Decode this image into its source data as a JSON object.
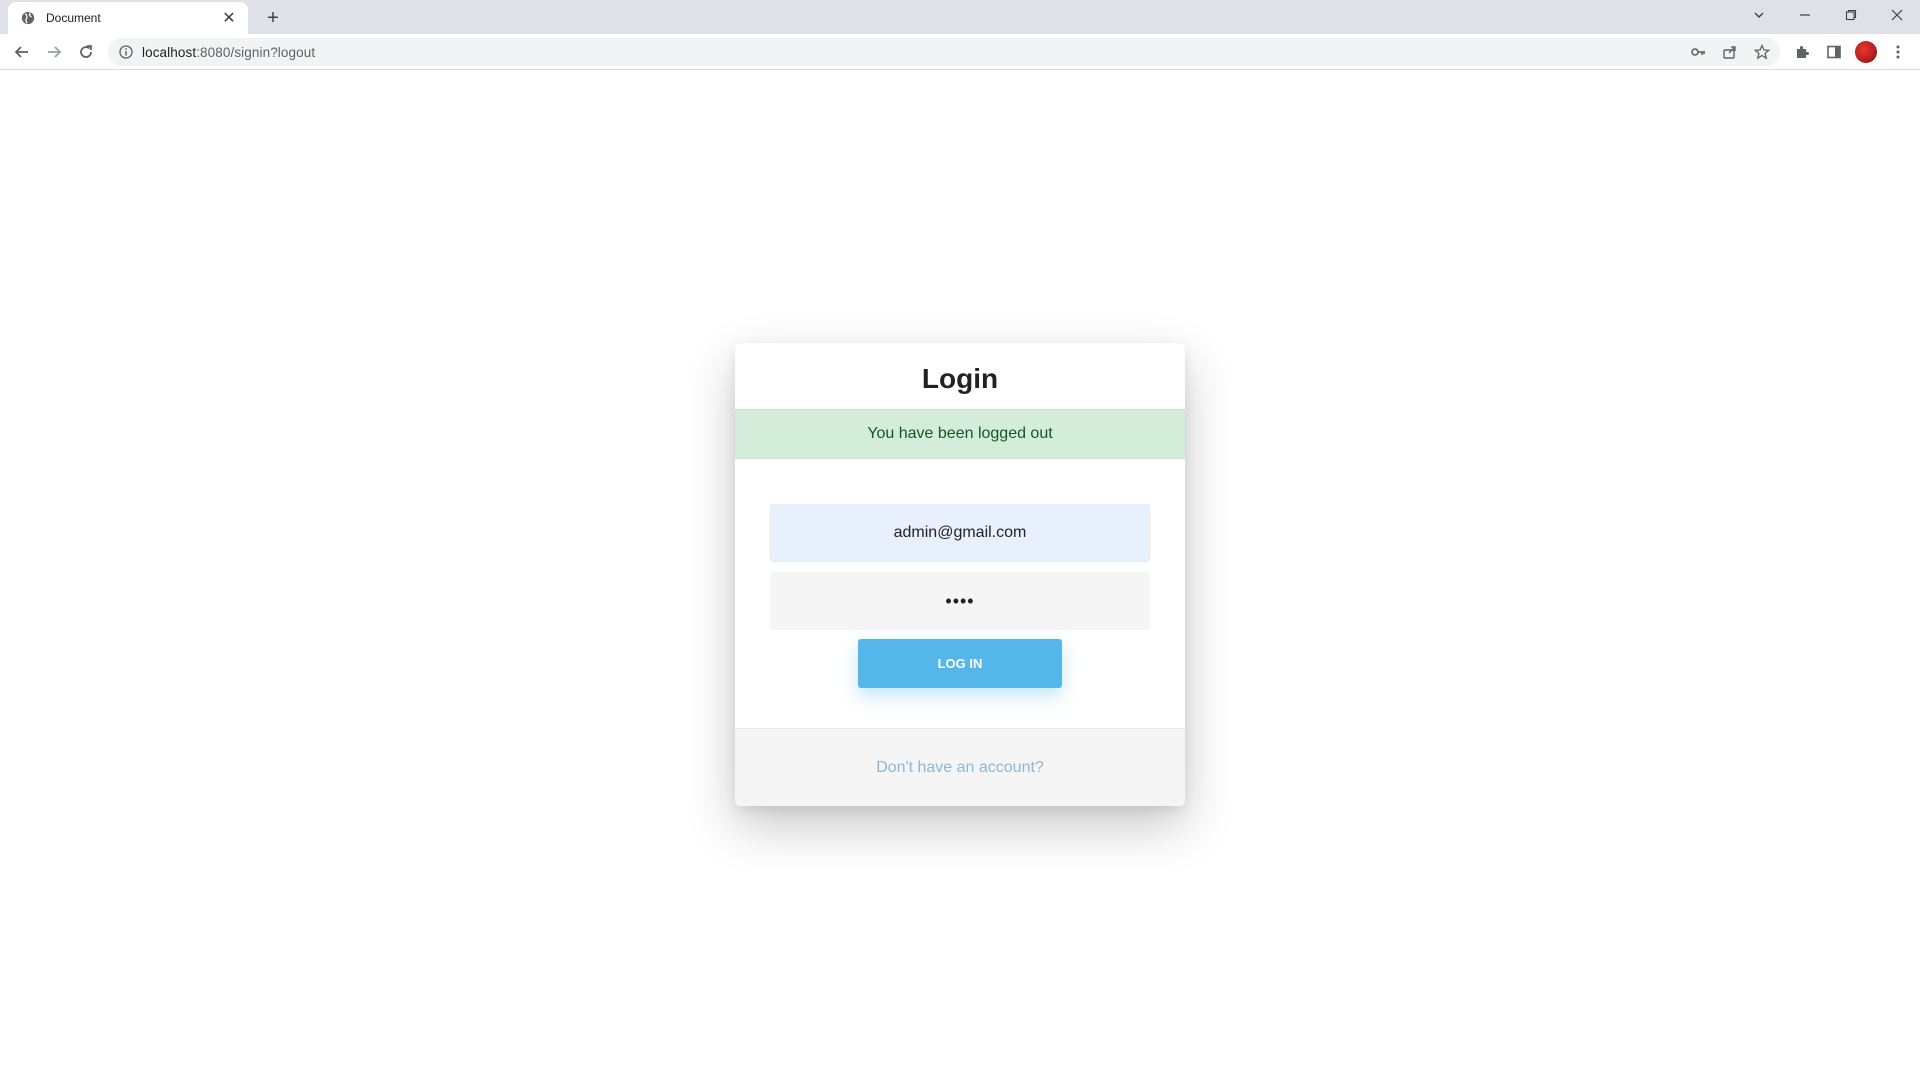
{
  "browser": {
    "tab_title": "Document",
    "tab_close": "✕",
    "new_tab": "+",
    "url_host": "localhost",
    "url_rest": ":8080/signin?logout",
    "window_controls": {
      "tabs_dropdown": "⌄",
      "minimize": "–",
      "restore": "❐",
      "close": "✕"
    }
  },
  "login": {
    "title": "Login",
    "alert_message": "You have been logged out",
    "email_value": "admin@gmail.com",
    "password_value": "••••",
    "login_button_label": "LOG IN",
    "signup_link": "Don't have an account?"
  },
  "colors": {
    "alert_bg": "#d4edda",
    "alert_text": "#155724",
    "button_bg": "#55b6e9",
    "link": "#8ab8dc",
    "email_field_bg": "#e8f0fe"
  }
}
